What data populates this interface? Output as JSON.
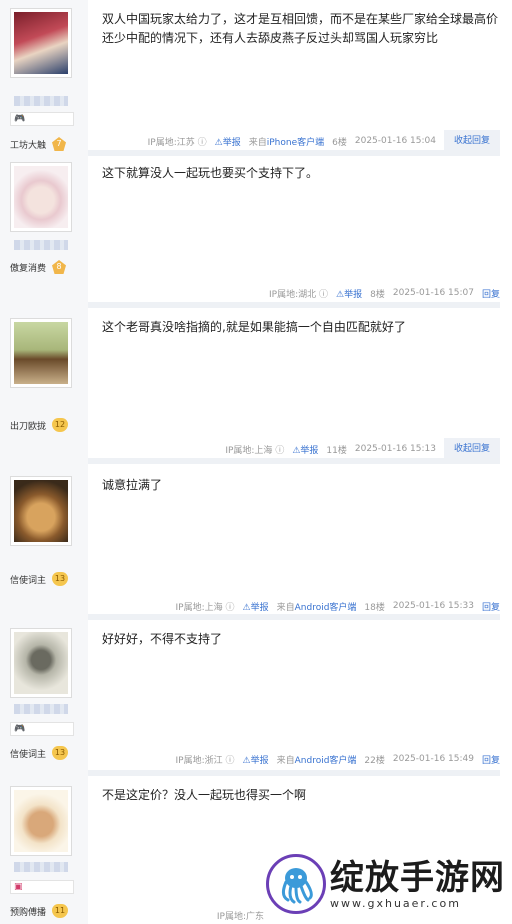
{
  "posts": [
    {
      "level_label": "工坊大触",
      "level_num": "7",
      "content": "双人中国玩家太给力了，这才是互相回馈，而不是在某些厂家给全球最高价还少中配的情况下，还有人去舔皮燕子反过头却骂国人玩家穷比",
      "ip": "IP属地:江苏",
      "report": "举报",
      "client_prefix": "来自",
      "client_name": "iPhone客户端",
      "floor": "6楼",
      "time": "2025-01-16 15:04",
      "reply": "收起回复"
    },
    {
      "level_label": "傲复消费",
      "level_num": "8",
      "content": "这下就算没人一起玩也要买个支持下了。",
      "ip": "IP属地:湖北",
      "report": "举报",
      "floor": "8楼",
      "time": "2025-01-16 15:07",
      "reply": "回复"
    },
    {
      "level_label": "出刀欧拢",
      "level_num": "12",
      "content": "这个老哥真没啥指摘的,就是如果能搞一个自由匹配就好了",
      "ip": "IP属地:上海",
      "report": "举报",
      "floor": "11楼",
      "time": "2025-01-16 15:13",
      "reply": "收起回复"
    },
    {
      "level_label": "信使词主",
      "level_num": "13",
      "content": "诚意拉满了",
      "ip": "IP属地:上海",
      "report": "举报",
      "client_prefix": "来自",
      "client_name": "Android客户端",
      "floor": "18楼",
      "time": "2025-01-16 15:33",
      "reply": "回复"
    },
    {
      "level_label": "信使词主",
      "level_num": "13",
      "content": "好好好，不得不支持了",
      "ip": "IP属地:浙江",
      "report": "举报",
      "client_prefix": "来自",
      "client_name": "Android客户端",
      "floor": "22楼",
      "time": "2025-01-16 15:49",
      "reply": "回复"
    },
    {
      "level_label": "预购傅播",
      "level_num": "11",
      "content": "不是这定价？没人一起玩也得买一个啊",
      "ip": "IP属地:广东"
    }
  ],
  "watermark": {
    "title": "绽放手游网",
    "url": "www.gxhuaer.com"
  }
}
